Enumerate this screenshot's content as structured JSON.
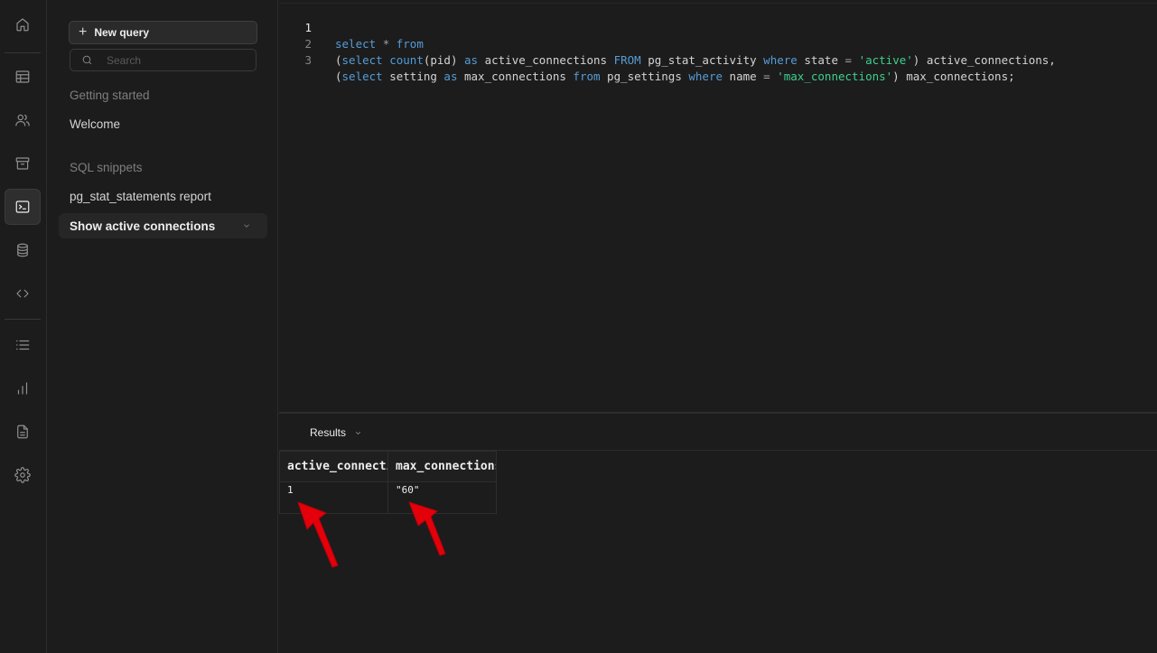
{
  "rail": {
    "icons": [
      "home-icon",
      "table-editor-icon",
      "users-icon",
      "storage-icon",
      "sql-editor-icon",
      "database-icon",
      "code-icon",
      "list-icon",
      "reports-icon",
      "docs-icon",
      "settings-icon"
    ],
    "active": "sql-editor-icon"
  },
  "sidebar": {
    "new_query_label": "New query",
    "search_placeholder": "Search",
    "section_getting_started": "Getting started",
    "welcome_label": "Welcome",
    "section_sql_snippets": "SQL snippets",
    "snippets": [
      {
        "label": "pg_stat_statements report"
      },
      {
        "label": "Show active connections"
      }
    ]
  },
  "editor": {
    "line_numbers": [
      "1",
      "2",
      "3"
    ],
    "current_line": "1",
    "lines": [
      "select * from",
      "(select count(pid) as active_connections FROM pg_stat_activity where state = 'active') active_connections,",
      "(select setting as max_connections from pg_settings where name = 'max_connections') max_connections;"
    ]
  },
  "results": {
    "tab_label": "Results",
    "columns": [
      "active_connections",
      "max_connections"
    ],
    "rows": [
      [
        "1",
        "\"60\""
      ]
    ]
  },
  "colors": {
    "keyword": "#569cd6",
    "string": "#3ecf8e",
    "annotation_arrow": "#e3000b"
  }
}
